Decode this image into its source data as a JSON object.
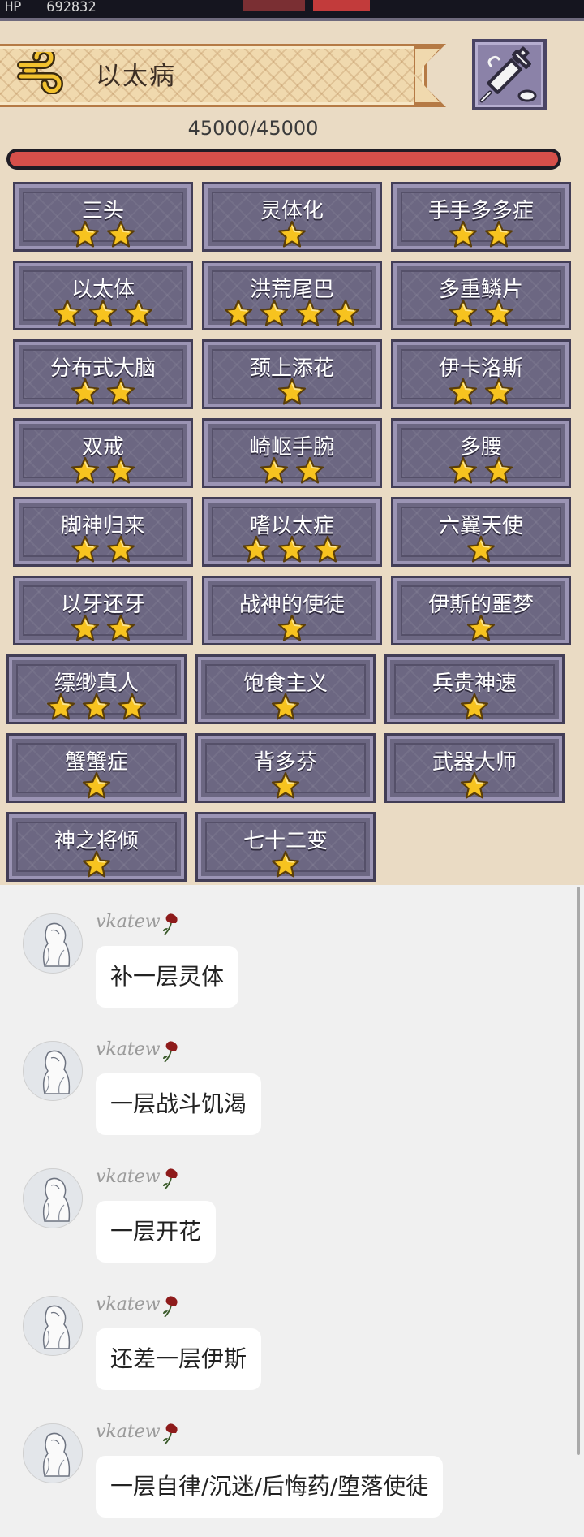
{
  "top": {
    "hp_label": "HP",
    "hp_value": "692832"
  },
  "panel": {
    "title": "以太病",
    "hp_text": "45000/45000",
    "hp_fraction": 1.0,
    "colors": {
      "hp_fill": "#d64f4a",
      "star": "#f7c31f",
      "tile": "#6c6782"
    },
    "icons": {
      "title_icon": "wind-swirl-icon",
      "action_icon": "syringe-icon"
    }
  },
  "skills": [
    {
      "name": "三头",
      "stars": 2
    },
    {
      "name": "灵体化",
      "stars": 1
    },
    {
      "name": "手手多多症",
      "stars": 2
    },
    {
      "name": "以太体",
      "stars": 3
    },
    {
      "name": "洪荒尾巴",
      "stars": 4
    },
    {
      "name": "多重鳞片",
      "stars": 2
    },
    {
      "name": "分布式大脑",
      "stars": 2
    },
    {
      "name": "颈上添花",
      "stars": 1
    },
    {
      "name": "伊卡洛斯",
      "stars": 2
    },
    {
      "name": "双戒",
      "stars": 2
    },
    {
      "name": "崎岖手腕",
      "stars": 2
    },
    {
      "name": "多腰",
      "stars": 2
    },
    {
      "name": "脚神归来",
      "stars": 2
    },
    {
      "name": "嗜以太症",
      "stars": 3
    },
    {
      "name": "六翼天使",
      "stars": 1
    },
    {
      "name": "以牙还牙",
      "stars": 2
    },
    {
      "name": "战神的使徒",
      "stars": 1
    },
    {
      "name": "伊斯的噩梦",
      "stars": 1
    },
    {
      "name": "缥缈真人",
      "stars": 3
    },
    {
      "name": "饱食主义",
      "stars": 1
    },
    {
      "name": "兵贵神速",
      "stars": 1
    },
    {
      "name": "蟹蟹症",
      "stars": 1
    },
    {
      "name": "背多芬",
      "stars": 1
    },
    {
      "name": "武器大师",
      "stars": 1
    },
    {
      "name": "神之将倾",
      "stars": 1
    },
    {
      "name": "七十二变",
      "stars": 1
    }
  ],
  "chat": {
    "messages": [
      {
        "user": "vkatew",
        "text": "补一层灵体"
      },
      {
        "user": "vkatew",
        "text": "一层战斗饥渴"
      },
      {
        "user": "vkatew",
        "text": "一层开花"
      },
      {
        "user": "vkatew",
        "text": "还差一层伊斯"
      },
      {
        "user": "vkatew",
        "text": "一层自律/沉迷/后悔药/堕落使徒"
      }
    ]
  }
}
